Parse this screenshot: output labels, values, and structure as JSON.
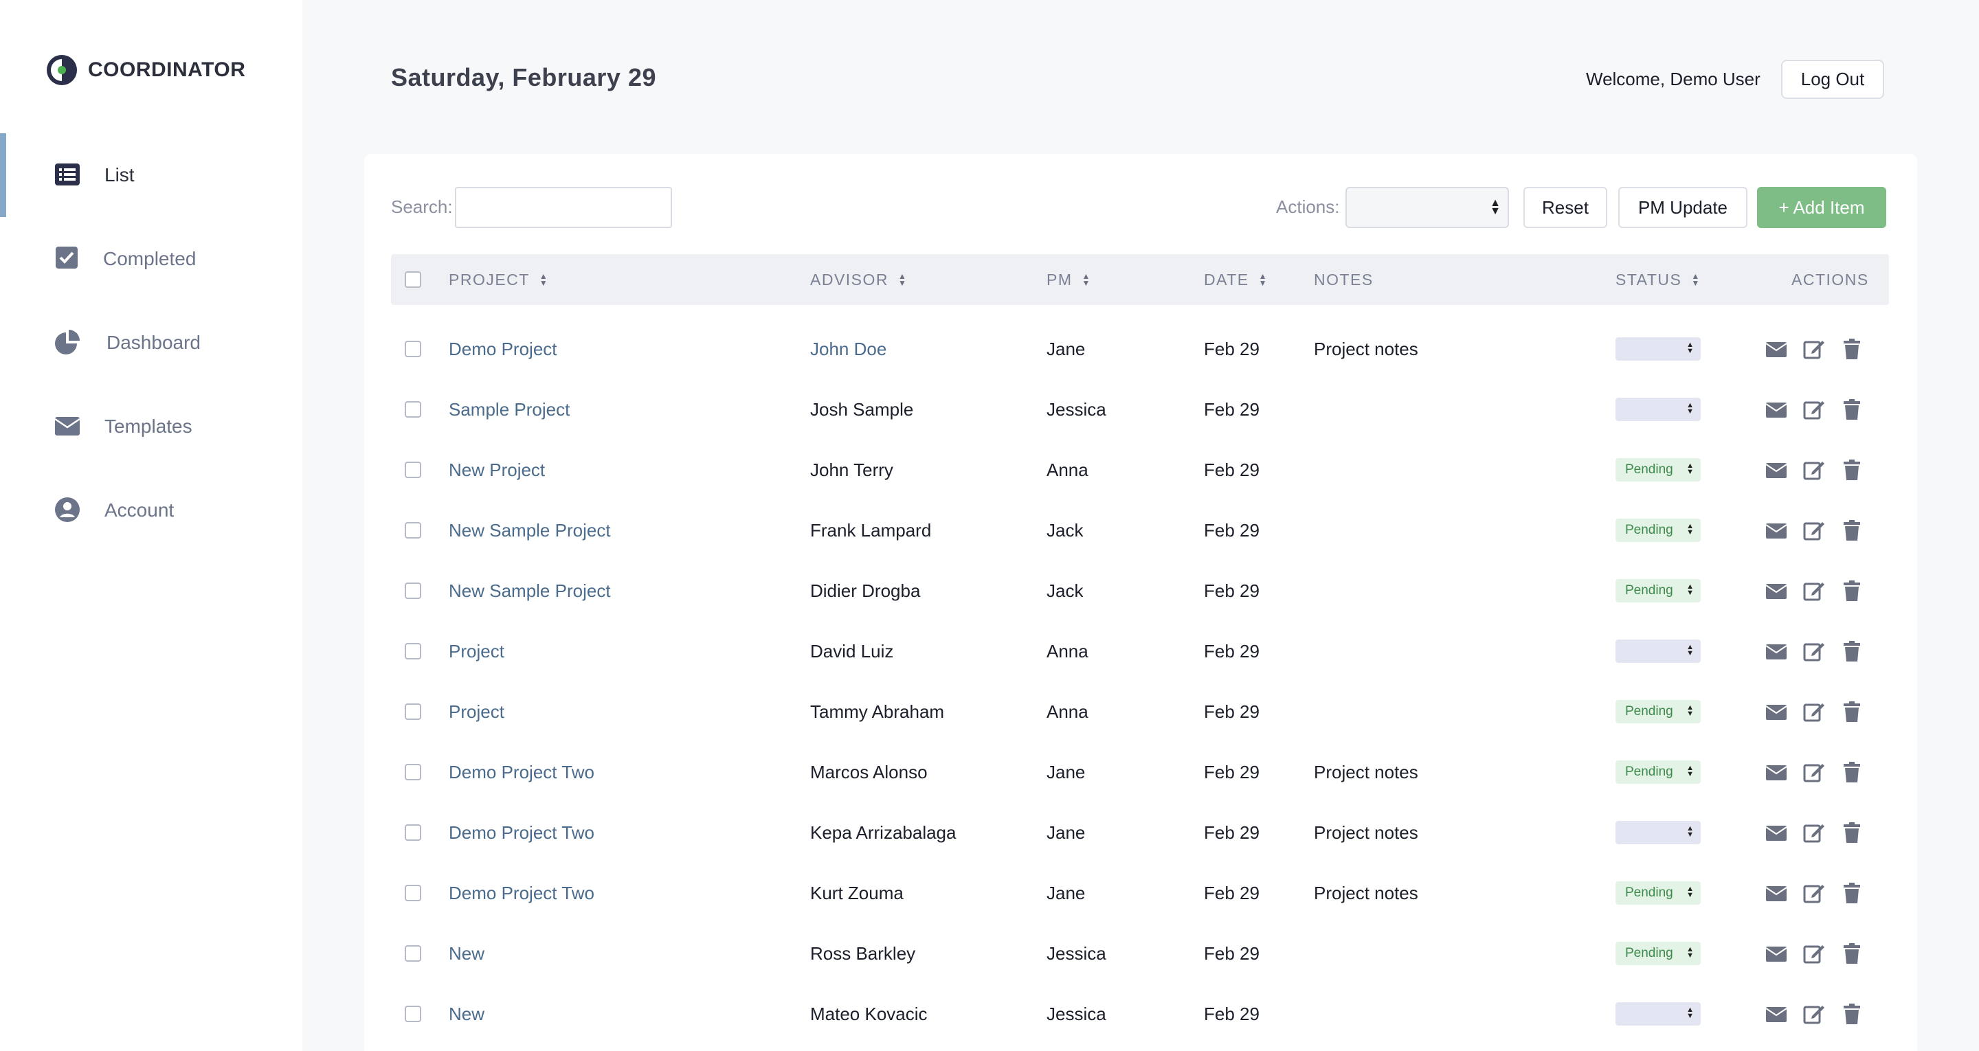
{
  "brand": {
    "name": "COORDINATOR",
    "logo_icon": "half-circle-logo-icon"
  },
  "nav": {
    "items": [
      {
        "label": "List",
        "icon": "list-icon",
        "active": true
      },
      {
        "label": "Completed",
        "icon": "checkbox-icon",
        "active": false
      },
      {
        "label": "Dashboard",
        "icon": "pie-chart-icon",
        "active": false
      },
      {
        "label": "Templates",
        "icon": "envelope-icon",
        "active": false
      },
      {
        "label": "Account",
        "icon": "user-circle-icon",
        "active": false
      }
    ]
  },
  "header": {
    "date": "Saturday, February 29",
    "welcome": "Welcome, Demo User",
    "logout_label": "Log Out"
  },
  "toolbar": {
    "search_label": "Search:",
    "search_value": "",
    "actions_label": "Actions:",
    "actions_selected": "",
    "reset_label": "Reset",
    "pm_update_label": "PM Update",
    "add_item_label": "+ Add Item"
  },
  "table": {
    "columns": {
      "project": "PROJECT",
      "advisor": "ADVISOR",
      "pm": "PM",
      "date": "DATE",
      "notes": "NOTES",
      "status": "STATUS",
      "actions": "ACTIONS"
    },
    "rows": [
      {
        "project": "Demo Project",
        "advisor": "John Doe",
        "advisor_link": true,
        "pm": "Jane",
        "date": "Feb 29",
        "notes": "Project notes",
        "status": ""
      },
      {
        "project": "Sample Project",
        "advisor": "Josh Sample",
        "advisor_link": false,
        "pm": "Jessica",
        "date": "Feb 29",
        "notes": "",
        "status": ""
      },
      {
        "project": "New Project",
        "advisor": "John Terry",
        "advisor_link": false,
        "pm": "Anna",
        "date": "Feb 29",
        "notes": "",
        "status": "Pending"
      },
      {
        "project": "New Sample Project",
        "advisor": "Frank Lampard",
        "advisor_link": false,
        "pm": "Jack",
        "date": "Feb 29",
        "notes": "",
        "status": "Pending"
      },
      {
        "project": "New Sample Project",
        "advisor": "Didier Drogba",
        "advisor_link": false,
        "pm": "Jack",
        "date": "Feb 29",
        "notes": "",
        "status": "Pending"
      },
      {
        "project": "Project",
        "advisor": "David Luiz",
        "advisor_link": false,
        "pm": "Anna",
        "date": "Feb 29",
        "notes": "",
        "status": ""
      },
      {
        "project": "Project",
        "advisor": "Tammy Abraham",
        "advisor_link": false,
        "pm": "Anna",
        "date": "Feb 29",
        "notes": "",
        "status": "Pending"
      },
      {
        "project": "Demo Project Two",
        "advisor": "Marcos Alonso",
        "advisor_link": false,
        "pm": "Jane",
        "date": "Feb 29",
        "notes": "Project notes",
        "status": "Pending"
      },
      {
        "project": "Demo Project Two",
        "advisor": "Kepa Arrizabalaga",
        "advisor_link": false,
        "pm": "Jane",
        "date": "Feb 29",
        "notes": "Project notes",
        "status": ""
      },
      {
        "project": "Demo Project Two",
        "advisor": "Kurt Zouma",
        "advisor_link": false,
        "pm": "Jane",
        "date": "Feb 29",
        "notes": "Project notes",
        "status": "Pending"
      },
      {
        "project": "New",
        "advisor": "Ross Barkley",
        "advisor_link": false,
        "pm": "Jessica",
        "date": "Feb 29",
        "notes": "",
        "status": "Pending"
      },
      {
        "project": "New",
        "advisor": "Mateo Kovacic",
        "advisor_link": false,
        "pm": "Jessica",
        "date": "Feb 29",
        "notes": "",
        "status": ""
      }
    ],
    "row_action_icons": [
      "envelope-icon",
      "edit-icon",
      "trash-icon"
    ]
  },
  "colors": {
    "accent_link": "#4a6b8c",
    "add_button": "#7fbd86",
    "active_nav_bar": "#86a8c8",
    "pending_bg": "#e3f3e6",
    "pending_text": "#3e8a4b"
  }
}
